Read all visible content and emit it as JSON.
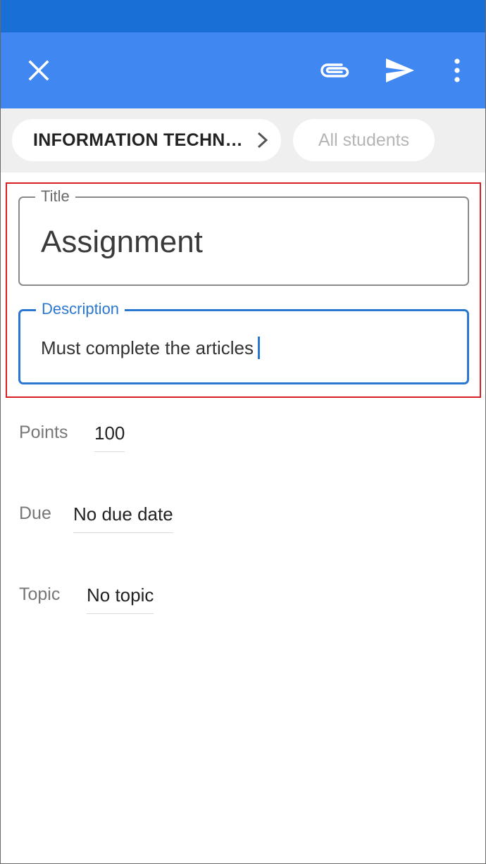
{
  "app_bar": {
    "close_icon": "close-icon",
    "attach_icon": "paperclip-icon",
    "send_icon": "send-icon",
    "more_icon": "more-vert-icon",
    "color": "#4187f2",
    "status_color": "#1a6fd6"
  },
  "chips": {
    "class_label": "INFORMATION TECHN…",
    "students_label": "All students"
  },
  "form": {
    "title_label": "Title",
    "title_value": "Assignment",
    "description_label": "Description",
    "description_value": "Must complete the articles"
  },
  "details": {
    "points_label": "Points",
    "points_value": "100",
    "due_label": "Due",
    "due_value": "No due date",
    "topic_label": "Topic",
    "topic_value": "No topic"
  }
}
